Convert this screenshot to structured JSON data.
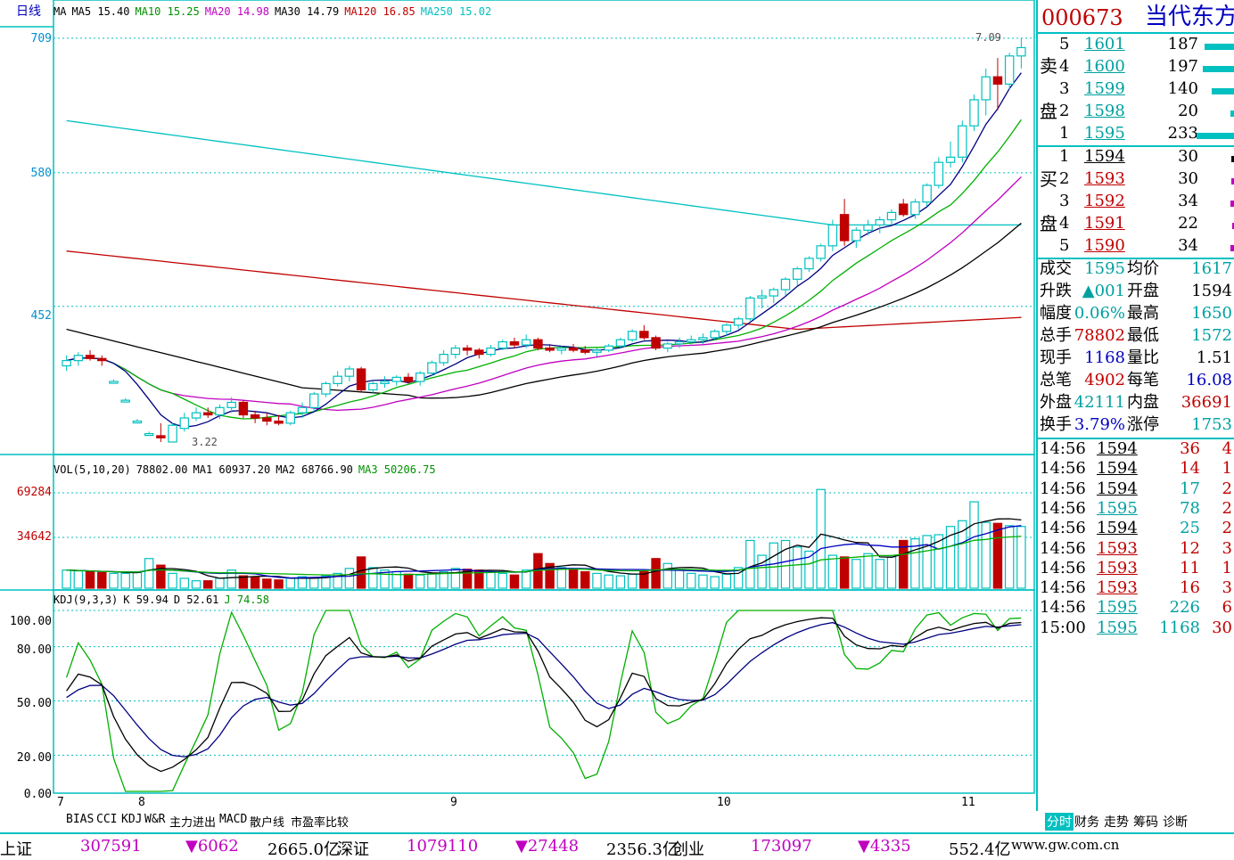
{
  "header": {
    "period": "日线",
    "ma_labels": [
      {
        "text": "MA",
        "color": "#000000"
      },
      {
        "text": "MA5 15.40",
        "color": "#000000"
      },
      {
        "text": "MA10 15.25",
        "color": "#009000"
      },
      {
        "text": "MA20 14.98",
        "color": "#c000c0"
      },
      {
        "text": "MA30 14.79",
        "color": "#000000"
      },
      {
        "text": "MA120 16.85",
        "color": "#c00000"
      },
      {
        "text": "MA250 15.02",
        "color": "#00c0c0"
      }
    ]
  },
  "price_axis": [
    "709",
    "580",
    "452"
  ],
  "price_annotations": {
    "high": "7.09",
    "low": "3.22"
  },
  "x_axis": [
    "7",
    "8",
    "9",
    "10",
    "11"
  ],
  "vol": {
    "legend": [
      {
        "text": "VOL(5,10,20)",
        "color": "#000000"
      },
      {
        "text": "78802.00",
        "color": "#000000"
      },
      {
        "text": "MA1 60937.20",
        "color": "#000000"
      },
      {
        "text": "MA2 68766.90",
        "color": "#000000"
      },
      {
        "text": "MA3 50206.75",
        "color": "#009000"
      }
    ],
    "axis": [
      "69284",
      "34642"
    ]
  },
  "kdj": {
    "legend": [
      {
        "text": "KDJ(9,3,3)",
        "color": "#000000"
      },
      {
        "text": "K 59.94",
        "color": "#000000"
      },
      {
        "text": "D 52.61",
        "color": "#000000"
      },
      {
        "text": "J 74.58",
        "color": "#009000"
      }
    ],
    "axis": [
      "100.00",
      "80.00",
      "50.00",
      "20.00",
      "0.00"
    ]
  },
  "bottom_tabs": [
    "BIAS",
    "CCI",
    "KDJ",
    "W&R",
    "主力进出",
    "MACD",
    "散户线",
    "市盈率比较"
  ],
  "stock": {
    "code": "000673",
    "name": "当代东方"
  },
  "sell_label": [
    "卖",
    "盘"
  ],
  "buy_label": [
    "买",
    "盘"
  ],
  "sell_book": [
    {
      "level": "5",
      "price": "1601",
      "qty": "187",
      "bar": 0.55
    },
    {
      "level": "4",
      "price": "1600",
      "qty": "197",
      "bar": 0.58
    },
    {
      "level": "3",
      "price": "1599",
      "qty": "140",
      "bar": 0.42
    },
    {
      "level": "2",
      "price": "1598",
      "qty": "20",
      "bar": 0.06
    },
    {
      "level": "1",
      "price": "1595",
      "qty": "233",
      "bar": 0.7
    }
  ],
  "buy_book": [
    {
      "level": "1",
      "price": "1594",
      "qty": "30",
      "bar": 0.05
    },
    {
      "level": "2",
      "price": "1593",
      "qty": "30",
      "bar": 0.05
    },
    {
      "level": "3",
      "price": "1592",
      "qty": "34",
      "bar": 0.06
    },
    {
      "level": "4",
      "price": "1591",
      "qty": "22",
      "bar": 0.04
    },
    {
      "level": "5",
      "price": "1590",
      "qty": "34",
      "bar": 0.06
    }
  ],
  "quote": [
    {
      "l1": "成交",
      "v1": "1595",
      "l2": "均价",
      "v2": "1617",
      "c1": "cyan",
      "c2": "cyan"
    },
    {
      "l1": "升跌",
      "v1": "▲001",
      "l2": "开盘",
      "v2": "1594",
      "c1": "cyan",
      "c2": "black"
    },
    {
      "l1": "幅度",
      "v1": "0.06%",
      "l2": "最高",
      "v2": "1650",
      "c1": "cyan",
      "c2": "cyan"
    },
    {
      "l1": "总手",
      "v1": "78802",
      "l2": "最低",
      "v2": "1572",
      "c1": "red",
      "c2": "cyan"
    },
    {
      "l1": "现手",
      "v1": "1168",
      "l2": "量比",
      "v2": "1.51",
      "c1": "blue",
      "c2": "black"
    },
    {
      "l1": "总笔",
      "v1": "4902",
      "l2": "每笔",
      "v2": "16.08",
      "c1": "red",
      "c2": "blue"
    },
    {
      "l1": "外盘",
      "v1": "42111",
      "l2": "内盘",
      "v2": "36691",
      "c1": "cyan",
      "c2": "red"
    },
    {
      "l1": "换手",
      "v1": "3.79%",
      "l2": "涨停",
      "v2": "1753",
      "c1": "blue",
      "c2": "cyan"
    }
  ],
  "ticks": [
    {
      "time": "14:56",
      "price": "1594",
      "vol": "36",
      "n": "4",
      "pc": "black",
      "vc": "red"
    },
    {
      "time": "14:56",
      "price": "1594",
      "vol": "14",
      "n": "1",
      "pc": "black",
      "vc": "red"
    },
    {
      "time": "14:56",
      "price": "1594",
      "vol": "17",
      "n": "2",
      "pc": "black",
      "vc": "cyan"
    },
    {
      "time": "14:56",
      "price": "1595",
      "vol": "78",
      "n": "2",
      "pc": "cyan",
      "vc": "cyan"
    },
    {
      "time": "14:56",
      "price": "1594",
      "vol": "25",
      "n": "2",
      "pc": "black",
      "vc": "cyan"
    },
    {
      "time": "14:56",
      "price": "1593",
      "vol": "12",
      "n": "3",
      "pc": "red",
      "vc": "red"
    },
    {
      "time": "14:56",
      "price": "1593",
      "vol": "11",
      "n": "1",
      "pc": "red",
      "vc": "red"
    },
    {
      "time": "14:56",
      "price": "1593",
      "vol": "16",
      "n": "3",
      "pc": "red",
      "vc": "red"
    },
    {
      "time": "14:56",
      "price": "1595",
      "vol": "226",
      "n": "6",
      "pc": "cyan",
      "vc": "cyan"
    },
    {
      "time": "15:00",
      "price": "1595",
      "vol": "1168",
      "n": "30",
      "pc": "cyan",
      "vc": "cyan"
    }
  ],
  "right_tabs": [
    "分时",
    "财务",
    "走势",
    "筹码",
    "诊断"
  ],
  "status": [
    {
      "text": "上证",
      "color": "#000000"
    },
    {
      "text": "307591",
      "color": "#c000c0"
    },
    {
      "text": "▼6062",
      "color": "#c000c0"
    },
    {
      "text": "2665.0亿",
      "color": "#000000"
    },
    {
      "text": "深证",
      "color": "#000000"
    },
    {
      "text": "1079110",
      "color": "#c000c0"
    },
    {
      "text": "▼27448",
      "color": "#c000c0"
    },
    {
      "text": "2356.3亿",
      "color": "#000000"
    },
    {
      "text": "创业",
      "color": "#000000"
    },
    {
      "text": "173097",
      "color": "#c000c0"
    },
    {
      "text": "▼4335",
      "color": "#c000c0"
    },
    {
      "text": "552.4亿",
      "color": "#000000"
    },
    {
      "text": "www.gw.com.cn",
      "color": "#000000"
    }
  ],
  "colors": {
    "up": "#00c0c0",
    "down": "#c00000",
    "grid": "#00c0c0"
  },
  "chart_data": {
    "type": "candlestick",
    "price_ylim": [
      3.1,
      7.2
    ],
    "candles": [
      [
        3.95,
        4.05,
        3.9,
        4.0
      ],
      [
        4.0,
        4.08,
        3.95,
        4.05
      ],
      [
        4.05,
        4.1,
        4.0,
        4.02
      ],
      [
        4.02,
        4.05,
        3.95,
        4.0
      ],
      [
        3.8,
        3.82,
        3.78,
        3.8
      ],
      [
        3.62,
        3.64,
        3.6,
        3.62
      ],
      [
        3.42,
        3.44,
        3.4,
        3.42
      ],
      [
        3.3,
        3.32,
        3.28,
        3.3
      ],
      [
        3.28,
        3.4,
        3.22,
        3.26
      ],
      [
        3.22,
        3.4,
        3.22,
        3.38
      ],
      [
        3.35,
        3.5,
        3.32,
        3.45
      ],
      [
        3.45,
        3.55,
        3.42,
        3.5
      ],
      [
        3.5,
        3.55,
        3.45,
        3.48
      ],
      [
        3.48,
        3.58,
        3.44,
        3.55
      ],
      [
        3.55,
        3.65,
        3.5,
        3.6
      ],
      [
        3.6,
        3.62,
        3.45,
        3.48
      ],
      [
        3.48,
        3.52,
        3.4,
        3.45
      ],
      [
        3.45,
        3.5,
        3.38,
        3.42
      ],
      [
        3.42,
        3.48,
        3.38,
        3.4
      ],
      [
        3.4,
        3.52,
        3.38,
        3.5
      ],
      [
        3.5,
        3.6,
        3.45,
        3.55
      ],
      [
        3.55,
        3.7,
        3.52,
        3.68
      ],
      [
        3.68,
        3.8,
        3.65,
        3.78
      ],
      [
        3.78,
        3.9,
        3.75,
        3.85
      ],
      [
        3.85,
        3.95,
        3.8,
        3.92
      ],
      [
        3.92,
        3.94,
        3.7,
        3.72
      ],
      [
        3.72,
        3.8,
        3.68,
        3.78
      ],
      [
        3.78,
        3.85,
        3.74,
        3.8
      ],
      [
        3.8,
        3.86,
        3.76,
        3.84
      ],
      [
        3.84,
        3.88,
        3.78,
        3.8
      ],
      [
        3.8,
        3.9,
        3.76,
        3.88
      ],
      [
        3.88,
        4.0,
        3.85,
        3.98
      ],
      [
        3.98,
        4.1,
        3.95,
        4.06
      ],
      [
        4.06,
        4.15,
        4.02,
        4.12
      ],
      [
        4.12,
        4.15,
        4.05,
        4.1
      ],
      [
        4.1,
        4.12,
        4.02,
        4.06
      ],
      [
        4.06,
        4.15,
        4.04,
        4.12
      ],
      [
        4.12,
        4.2,
        4.1,
        4.18
      ],
      [
        4.18,
        4.22,
        4.12,
        4.15
      ],
      [
        4.15,
        4.25,
        4.12,
        4.2
      ],
      [
        4.2,
        4.22,
        4.1,
        4.12
      ],
      [
        4.12,
        4.16,
        4.08,
        4.1
      ],
      [
        4.1,
        4.14,
        4.06,
        4.12
      ],
      [
        4.12,
        4.16,
        4.08,
        4.1
      ],
      [
        4.1,
        4.14,
        4.06,
        4.08
      ],
      [
        4.08,
        4.12,
        4.04,
        4.1
      ],
      [
        4.1,
        4.16,
        4.08,
        4.14
      ],
      [
        4.14,
        4.22,
        4.12,
        4.2
      ],
      [
        4.2,
        4.3,
        4.18,
        4.28
      ],
      [
        4.28,
        4.34,
        4.2,
        4.22
      ],
      [
        4.22,
        4.24,
        4.1,
        4.12
      ],
      [
        4.12,
        4.18,
        4.08,
        4.16
      ],
      [
        4.16,
        4.22,
        4.12,
        4.18
      ],
      [
        4.18,
        4.24,
        4.14,
        4.2
      ],
      [
        4.2,
        4.26,
        4.16,
        4.22
      ],
      [
        4.22,
        4.3,
        4.2,
        4.28
      ],
      [
        4.28,
        4.36,
        4.24,
        4.34
      ],
      [
        4.34,
        4.42,
        4.3,
        4.4
      ],
      [
        4.4,
        4.62,
        4.38,
        4.6
      ],
      [
        4.6,
        4.68,
        4.5,
        4.62
      ],
      [
        4.62,
        4.7,
        4.55,
        4.68
      ],
      [
        4.68,
        4.8,
        4.62,
        4.78
      ],
      [
        4.78,
        4.9,
        4.72,
        4.88
      ],
      [
        4.88,
        5.0,
        4.85,
        4.98
      ],
      [
        4.98,
        5.12,
        4.95,
        5.1
      ],
      [
        5.1,
        5.35,
        5.05,
        5.3
      ],
      [
        5.4,
        5.55,
        5.1,
        5.15
      ],
      [
        5.15,
        5.28,
        5.08,
        5.25
      ],
      [
        5.25,
        5.35,
        5.2,
        5.3
      ],
      [
        5.3,
        5.38,
        5.22,
        5.35
      ],
      [
        5.35,
        5.45,
        5.3,
        5.42
      ],
      [
        5.5,
        5.55,
        5.38,
        5.4
      ],
      [
        5.4,
        5.55,
        5.36,
        5.52
      ],
      [
        5.52,
        5.7,
        5.48,
        5.68
      ],
      [
        5.68,
        5.95,
        5.65,
        5.9
      ],
      [
        5.9,
        6.1,
        5.85,
        5.95
      ],
      [
        5.95,
        6.3,
        5.9,
        6.25
      ],
      [
        6.25,
        6.55,
        6.2,
        6.5
      ],
      [
        6.5,
        6.8,
        6.35,
        6.72
      ],
      [
        6.72,
        6.9,
        6.4,
        6.65
      ],
      [
        6.65,
        6.95,
        6.6,
        6.92
      ],
      [
        6.92,
        7.09,
        6.8,
        7.0
      ]
    ],
    "volumes": [
      22000,
      21000,
      20000,
      19000,
      18000,
      18000,
      19000,
      36000,
      28000,
      18000,
      12000,
      9000,
      9000,
      12000,
      22000,
      15000,
      13000,
      11000,
      10000,
      12000,
      14000,
      13000,
      15000,
      18000,
      24000,
      38000,
      25000,
      22000,
      20000,
      17000,
      16000,
      18000,
      20000,
      24000,
      23000,
      22000,
      20000,
      18000,
      16000,
      22000,
      42000,
      30000,
      25000,
      23000,
      20000,
      18000,
      16000,
      15000,
      17000,
      20000,
      36000,
      30000,
      22000,
      18000,
      16000,
      14000,
      17000,
      25000,
      58000,
      40000,
      55000,
      58000,
      50000,
      45000,
      120000,
      40000,
      38000,
      35000,
      42000,
      35000,
      38000,
      58000,
      60000,
      64000,
      65000,
      75000,
      82000,
      105000,
      80000,
      78802,
      76000,
      75000
    ],
    "kdj": {
      "K": [],
      "D": [],
      "J": []
    }
  }
}
